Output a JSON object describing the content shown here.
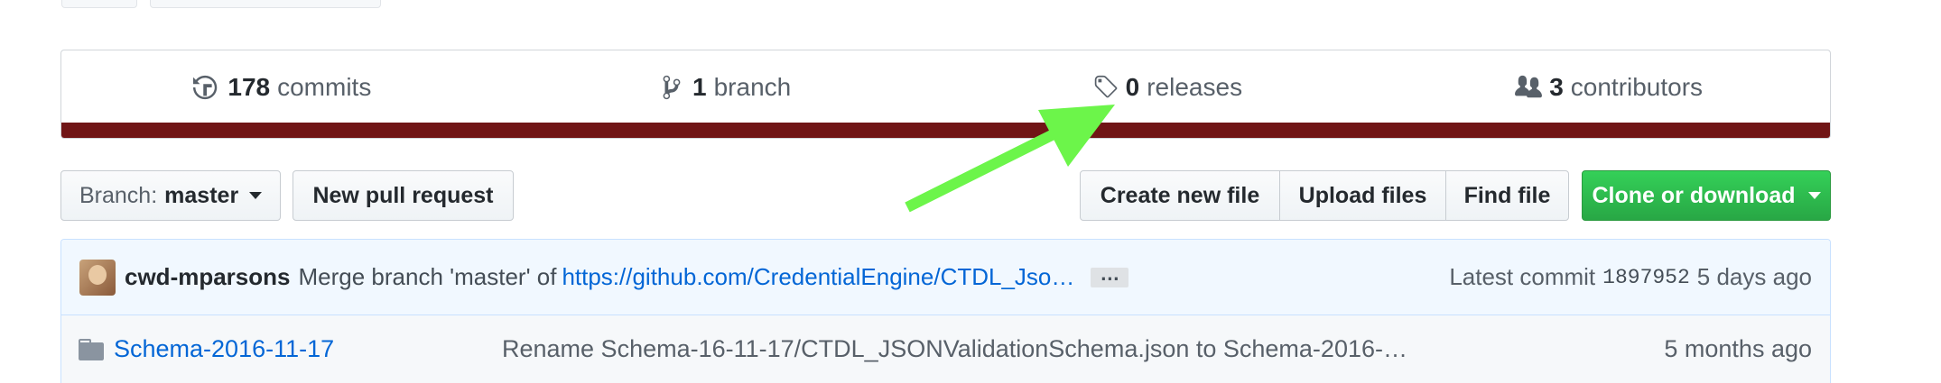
{
  "summary": {
    "commits": {
      "count": "178",
      "label": "commits",
      "icon": "history-icon"
    },
    "branches": {
      "count": "1",
      "label": "branch",
      "icon": "branch-icon"
    },
    "releases": {
      "count": "0",
      "label": "releases",
      "icon": "tag-icon"
    },
    "contributors": {
      "count": "3",
      "label": "contributors",
      "icon": "people-icon"
    },
    "language_color": "#701516"
  },
  "toolbar": {
    "branch_prefix": "Branch:",
    "branch_name": "master",
    "new_pr": "New pull request",
    "create_file": "Create new file",
    "upload_files": "Upload files",
    "find_file": "Find file",
    "clone": "Clone or download"
  },
  "commit": {
    "author": "cwd-mparsons",
    "message": "Merge branch 'master' of",
    "link": "https://github.com/CredentialEngine/CTDL_Jso…",
    "ellipsis": "…",
    "latest_label": "Latest commit",
    "sha": "1897952",
    "age": "5 days ago"
  },
  "files": [
    {
      "name": "Schema-2016-11-17",
      "message": "Rename Schema-16-11-17/CTDL_JSONValidationSchema.json to Schema-2016-…",
      "age": "5 months ago"
    }
  ],
  "colors": {
    "accent_green": "#28a745",
    "link_blue": "#0366d6",
    "annotation_arrow": "#6cf54a"
  }
}
